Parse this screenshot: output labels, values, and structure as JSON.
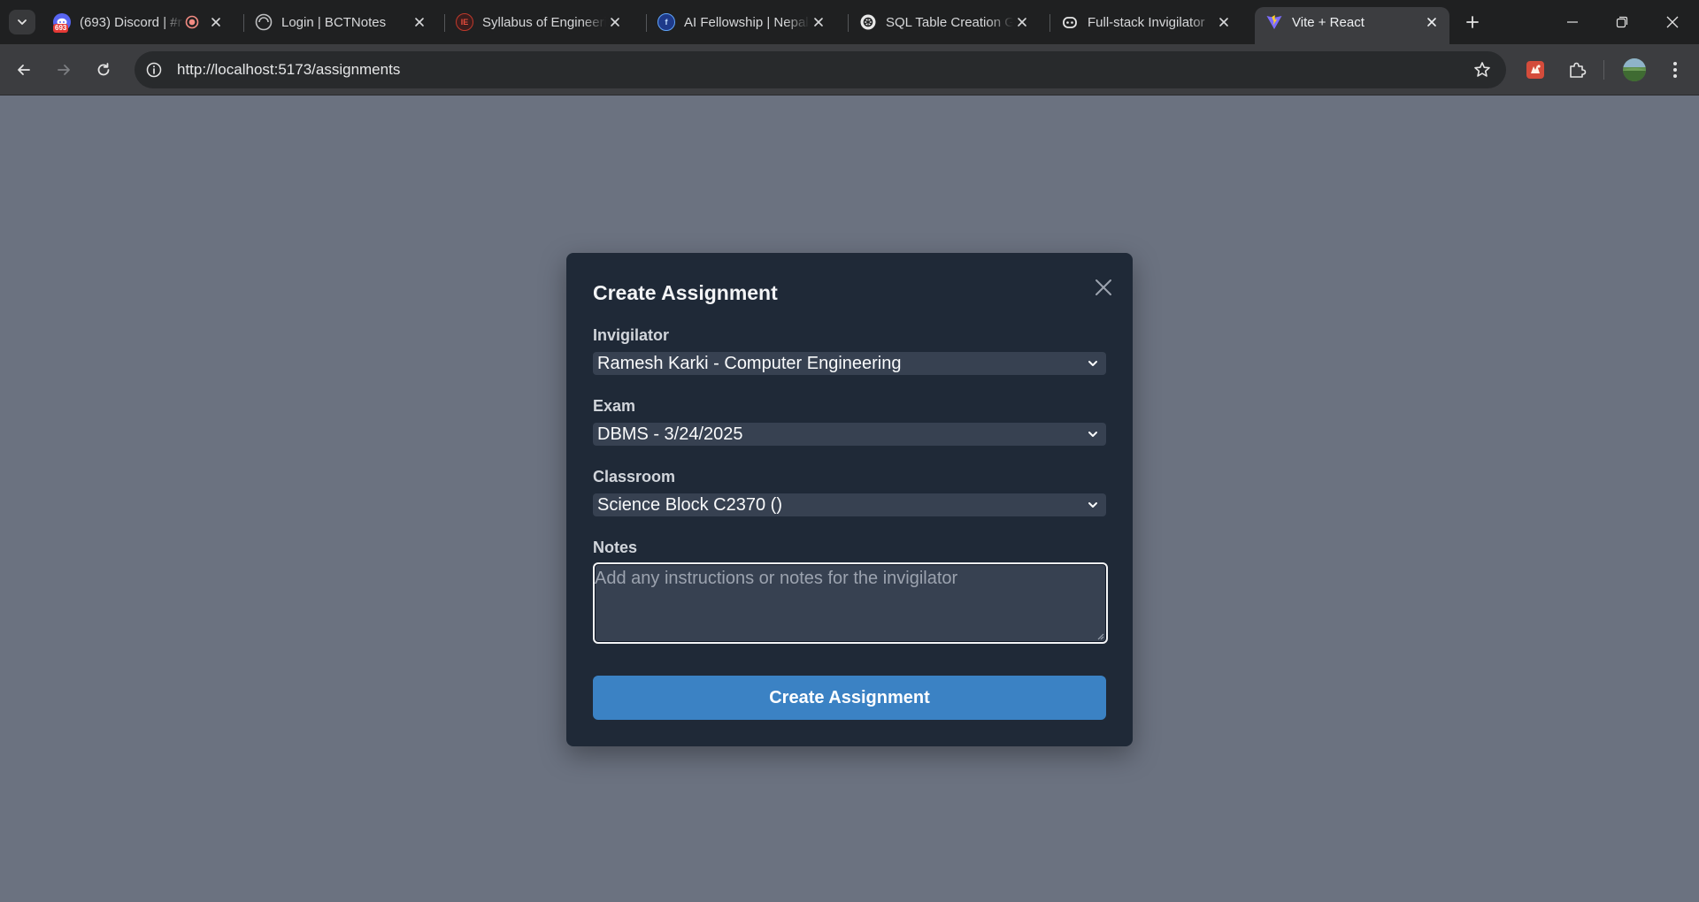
{
  "browser": {
    "tabs": [
      {
        "title": "(693) Discord | #r",
        "badge": "693"
      },
      {
        "title": "Login | BCTNotes"
      },
      {
        "title": "Syllabus of Engineering"
      },
      {
        "title": "AI Fellowship | Nepal"
      },
      {
        "title": "SQL Table Creation Guide"
      },
      {
        "title": "Full-stack Invigilator"
      },
      {
        "title": "Vite + React"
      }
    ],
    "url": "http://localhost:5173/assignments"
  },
  "modal": {
    "title": "Create Assignment",
    "invigilator": {
      "label": "Invigilator",
      "value": "Ramesh Karki - Computer Engineering"
    },
    "exam": {
      "label": "Exam",
      "value": "DBMS - 3/24/2025"
    },
    "classroom": {
      "label": "Classroom",
      "value": "Science Block C2370 ()"
    },
    "notes": {
      "label": "Notes",
      "placeholder": "Add any instructions or notes for the invigilator"
    },
    "submit_label": "Create Assignment"
  },
  "colors": {
    "backdrop": "#6b7280",
    "modal": "#1f2937",
    "field": "#374151",
    "primary": "#3b82c4"
  }
}
